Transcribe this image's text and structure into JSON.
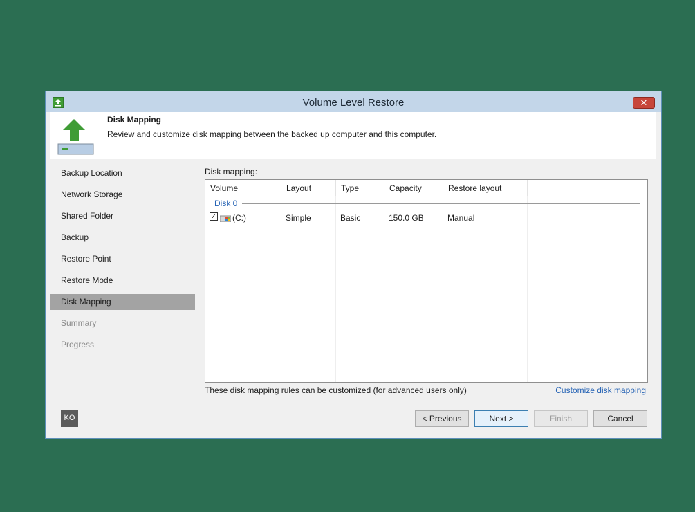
{
  "window": {
    "title": "Volume Level Restore",
    "close_label": "✕"
  },
  "header": {
    "title": "Disk Mapping",
    "description": "Review and customize disk mapping between the backed up computer and this computer."
  },
  "sidebar": {
    "items": [
      {
        "label": "Backup Location",
        "state": "normal"
      },
      {
        "label": "Network Storage",
        "state": "normal"
      },
      {
        "label": "Shared Folder",
        "state": "normal"
      },
      {
        "label": "Backup",
        "state": "normal"
      },
      {
        "label": "Restore Point",
        "state": "normal"
      },
      {
        "label": "Restore Mode",
        "state": "normal"
      },
      {
        "label": "Disk Mapping",
        "state": "active"
      },
      {
        "label": "Summary",
        "state": "disabled"
      },
      {
        "label": "Progress",
        "state": "disabled"
      }
    ]
  },
  "main": {
    "section_label": "Disk mapping:",
    "columns": [
      "Volume",
      "Layout",
      "Type",
      "Capacity",
      "Restore layout"
    ],
    "group": "Disk 0",
    "rows": [
      {
        "checked": true,
        "volume": "(C:)",
        "layout": "Simple",
        "type": "Basic",
        "capacity": "150.0 GB",
        "restore_layout": "Manual"
      }
    ],
    "footnote": "These disk mapping rules can be customized (for advanced users only)",
    "customize_link": "Customize disk mapping"
  },
  "footer": {
    "avatar": "KO",
    "previous": "< Previous",
    "next": "Next >",
    "finish": "Finish",
    "cancel": "Cancel"
  },
  "colors": {
    "background": "#2b6e52",
    "accent_green": "#3f9c35",
    "link_blue": "#2764b5",
    "active_nav": "#a3a3a3"
  }
}
